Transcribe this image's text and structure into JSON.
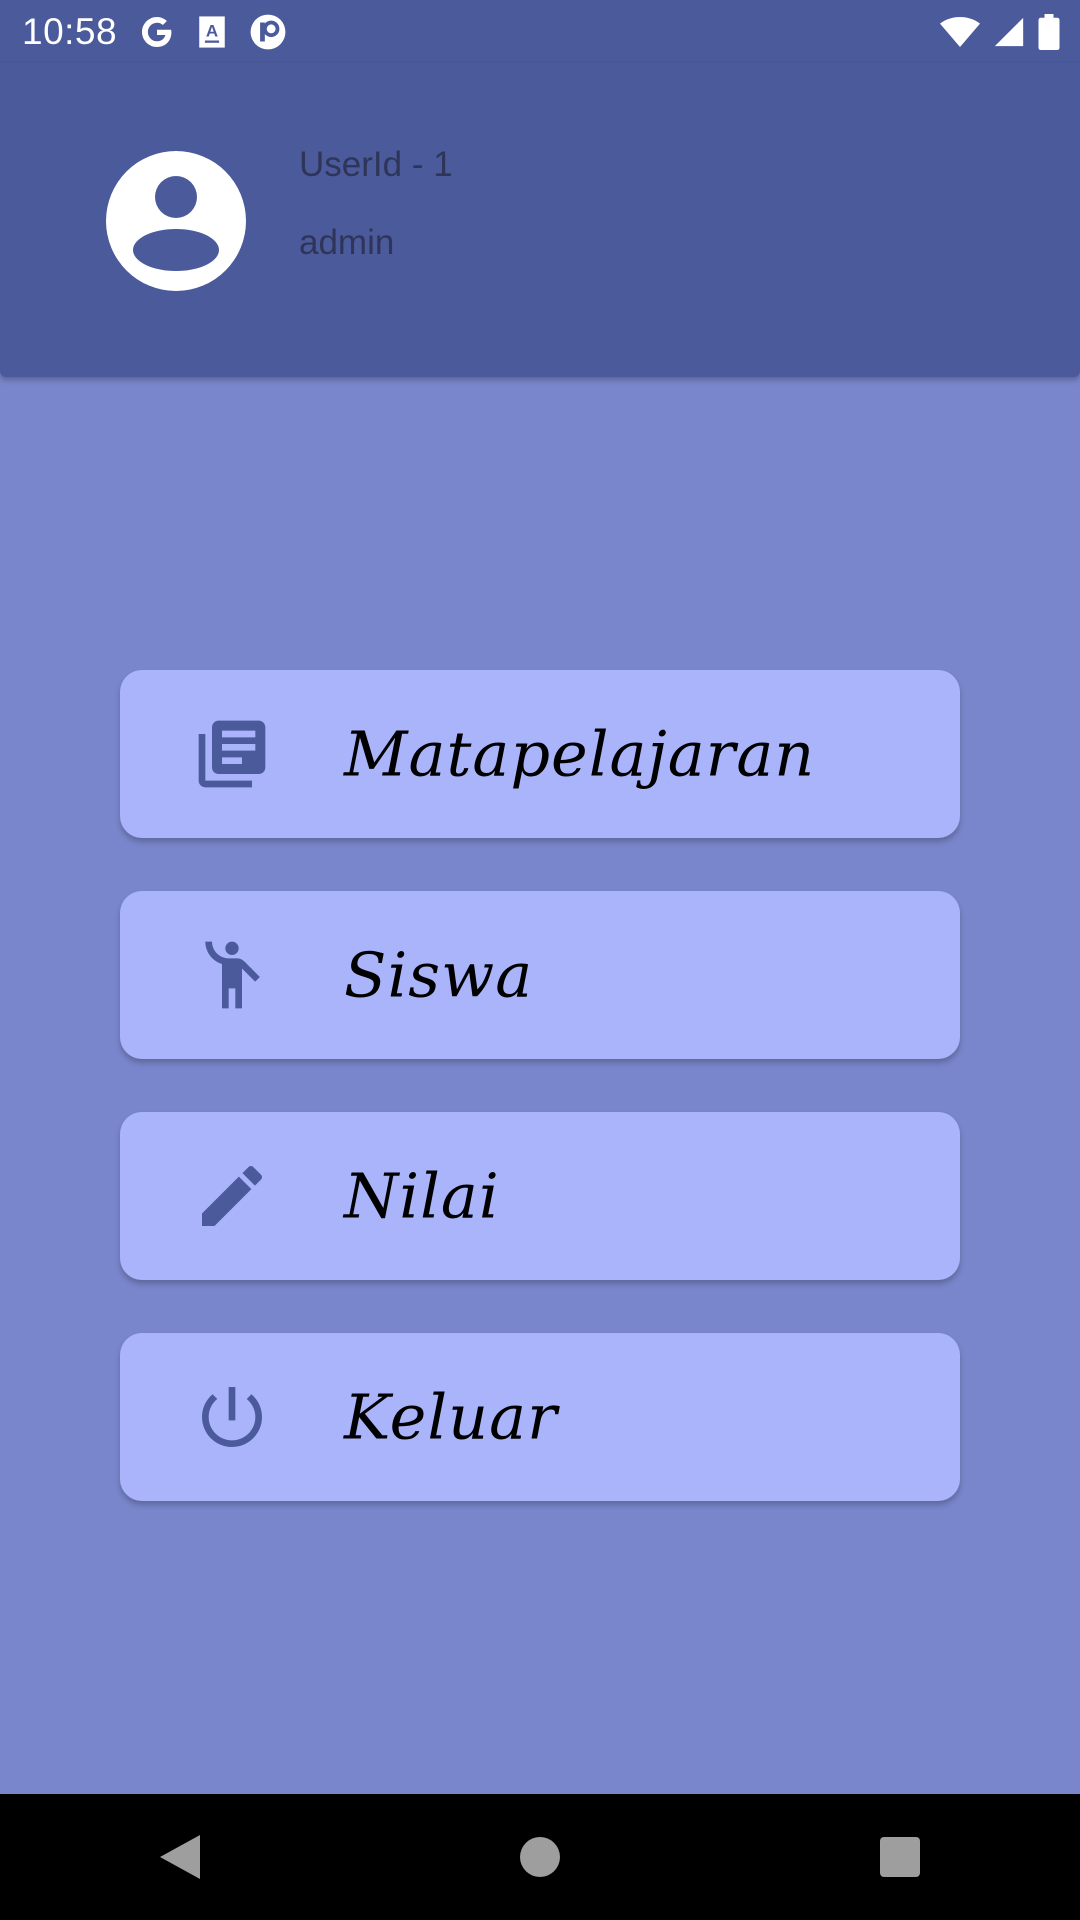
{
  "status_bar": {
    "time": "10:58",
    "left_icons": [
      "google-icon",
      "translate-icon",
      "app-icon"
    ],
    "right_icons": [
      "wifi-icon",
      "signal-icon",
      "battery-icon"
    ]
  },
  "header": {
    "user_id": "UserId - 1",
    "username": "admin",
    "avatar_icon": "account-circle-icon"
  },
  "menu": [
    {
      "label": "Matapelajaran",
      "icon": "library-books-icon"
    },
    {
      "label": "Siswa",
      "icon": "person-waving-icon"
    },
    {
      "label": "Nilai",
      "icon": "pencil-icon"
    },
    {
      "label": "Keluar",
      "icon": "power-icon"
    }
  ],
  "nav_bar": {
    "buttons": [
      "back-icon",
      "home-icon",
      "recents-icon"
    ]
  },
  "colors": {
    "background": "#7986cb",
    "header": "#4b5a9b",
    "card": "#a9b4fb",
    "icon": "#4b5a9b"
  }
}
